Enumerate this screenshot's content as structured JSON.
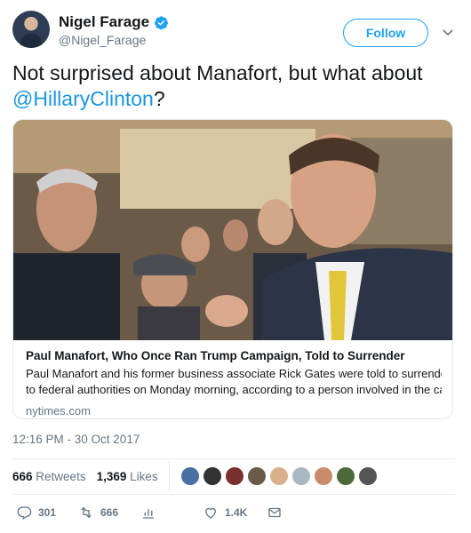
{
  "user": {
    "name": "Nigel Farage",
    "handle": "@Nigel_Farage"
  },
  "follow_label": "Follow",
  "tweet": {
    "text_before": "Not surprised about Manafort, but what about ",
    "mention": "@HillaryClinton",
    "text_after": "?"
  },
  "card": {
    "title": "Paul Manafort, Who Once Ran Trump Campaign, Told to Surrender",
    "description_line1": "Paul Manafort and his former business associate Rick Gates were told to surrender",
    "description_line2": "to federal authorities on Monday morning, according to a person involved in the ca...",
    "domain": "nytimes.com"
  },
  "timestamp": "12:16 PM - 30 Oct 2017",
  "stats": {
    "retweets_count": "666",
    "retweets_label": "Retweets",
    "likes_count": "1,369",
    "likes_label": "Likes"
  },
  "actions": {
    "replies": "301",
    "retweets": "666",
    "likes": "1.4K"
  },
  "icons": {
    "verified": "verified-badge-icon",
    "caret": "chevron-down-icon",
    "reply": "reply-icon",
    "retweet": "retweet-icon",
    "like": "heart-icon",
    "dm": "envelope-icon"
  },
  "colors": {
    "accent": "#1da1f2",
    "link": "#1b95e0",
    "muted": "#657786"
  }
}
